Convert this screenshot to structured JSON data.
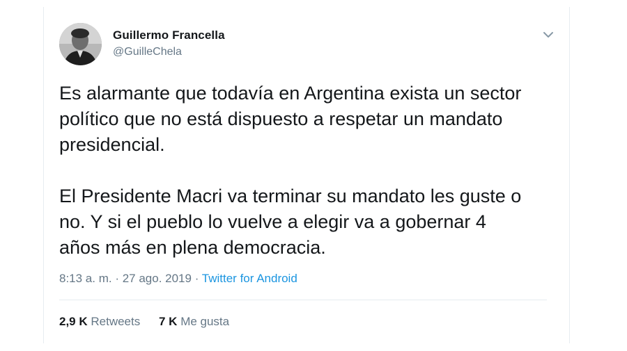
{
  "user": {
    "name": "Guillermo Francella",
    "handle": "@GuilleChela"
  },
  "tweet": {
    "text": "Es alarmante que todavía en Argentina exista un sector\npolítico que no está dispuesto a respetar un mandato\npresidencial.\n\nEl Presidente Macri va terminar su mandato les guste o\nno. Y si el pueblo lo vuelve a elegir va a gobernar 4\naños más en plena democracia.",
    "timestamp": "8:13 a. m. · 27 ago. 2019",
    "separator": " · ",
    "source": "Twitter for Android"
  },
  "stats": {
    "retweets_count": "2,9 K",
    "retweets_label": "Retweets",
    "likes_count": "7 K",
    "likes_label": "Me gusta"
  },
  "icons": {
    "caret": "chevron-down-icon",
    "avatar": "avatar"
  },
  "colors": {
    "text": "#14171a",
    "secondary": "#657786",
    "link": "#1b95e0",
    "divider": "#e6ecf0"
  }
}
